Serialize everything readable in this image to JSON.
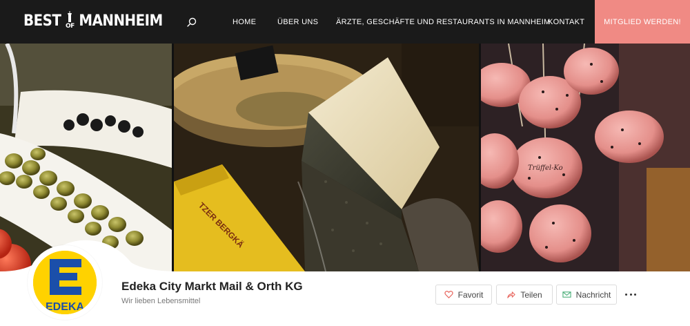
{
  "nav": {
    "logo": {
      "word1": "BEST",
      "of": "OF",
      "word2": "MANNHEIM"
    },
    "search_icon": "search-icon",
    "items": [
      {
        "label": "Home"
      },
      {
        "label": "Über uns"
      },
      {
        "label": "Ärzte, Geschäfte und Restaurants in Mannheim"
      },
      {
        "label": "Kontakt"
      }
    ],
    "cta_label": "Mitglied werden!"
  },
  "colors": {
    "nav_bg": "#1a1a1a",
    "cta_bg": "#f08a84",
    "edeka_yellow": "#ffd200",
    "edeka_blue": "#1b4faa"
  },
  "profile": {
    "logo_text": "EDEKA",
    "name": "Edeka City Markt Mail & Orth KG",
    "tagline": "Wir lieben Lebensmittel",
    "actions": {
      "favorit": "Favorit",
      "teilen": "Teilen",
      "nachricht": "Nachricht"
    },
    "more_icon": "more-dots-icon"
  },
  "hero": {
    "cheese_label": "TZER BERGKÄ",
    "sausage_label": "Trüffel-Ko"
  }
}
